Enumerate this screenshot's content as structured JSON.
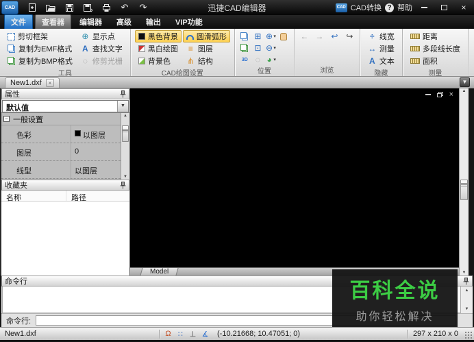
{
  "titlebar": {
    "logo": "CAD",
    "title": "迅捷CAD编辑器",
    "cad_convert": "CAD转换",
    "help": "帮助"
  },
  "menu_tabs": {
    "file": "文件",
    "viewer": "查看器",
    "editor": "编辑器",
    "advanced": "高级",
    "output": "输出",
    "vip": "VIP功能"
  },
  "ribbon": {
    "tools": {
      "label": "工具",
      "cut_frame": "剪切框架",
      "copy_emf": "复制为EMF格式",
      "copy_bmp": "复制为BMP格式",
      "show_point": "显示点",
      "find_text": "查找文字",
      "trim_raster": "修剪光栅"
    },
    "cad_draw": {
      "label": "CAD绘图设置",
      "black_bg": "黑色背景",
      "bw_draw": "黑白绘图",
      "bg_color": "背景色",
      "smooth_arc": "圆滑弧形",
      "layers": "图层",
      "structure": "结构"
    },
    "position": {
      "label": "位置"
    },
    "browse": {
      "label": "浏览"
    },
    "hide": {
      "label": "隐藏",
      "line_width": "线宽",
      "measure": "测量",
      "text": "文本"
    },
    "measure": {
      "label": "测量",
      "distance": "距离",
      "polyline": "多段线长度",
      "area": "面积"
    }
  },
  "document": {
    "tab": "New1.dxf"
  },
  "properties": {
    "title": "属性",
    "preset": "默认值",
    "group": "一般设置",
    "rows": [
      {
        "name": "色彩",
        "value": "以图层"
      },
      {
        "name": "图层",
        "value": "0"
      },
      {
        "name": "线型",
        "value": "以图层"
      }
    ]
  },
  "favorites": {
    "title": "收藏夹",
    "col_name": "名称",
    "col_path": "路径"
  },
  "canvas": {
    "model_tab": "Model"
  },
  "command": {
    "title": "命令行",
    "prompt": "命令行:"
  },
  "watermark": {
    "title": "百科全说",
    "subtitle": "助你轻松解决",
    "green": "#3ccc44"
  },
  "statusbar": {
    "file": "New1.dxf",
    "coords": "(-10.21668; 10.47051; 0)",
    "dims": "297 x 210 x 0"
  },
  "colors": {
    "highlight": "#fdd052",
    "file_tab_blue": "#1d6bc0",
    "canvas_bg": "#000000",
    "watermark_green": "#3ccc44"
  },
  "glyphs": {
    "dropdown": "▾",
    "undo": "↶",
    "redo": "↷",
    "show_point": "⊕",
    "find_a": "A",
    "zoom_window": "⊞",
    "zoom_in": "⊕",
    "zoom_out": "⊖",
    "fit": "⊡",
    "threed": "3D",
    "render": "◕",
    "circle_off": "◌",
    "back": "←",
    "fwd": "→",
    "view_undo": "↩",
    "view_redo": "↪",
    "layers": "≡",
    "structure": "⋔",
    "line_width": "÷",
    "measure": "↔",
    "text": "A",
    "close": "×",
    "help": "?",
    "ortho": "Ω",
    "grid": "∷",
    "perp": "⊥",
    "angle": "∡",
    "up": "▲",
    "down": "▼",
    "minus": "−",
    "sel_down": "▼"
  }
}
